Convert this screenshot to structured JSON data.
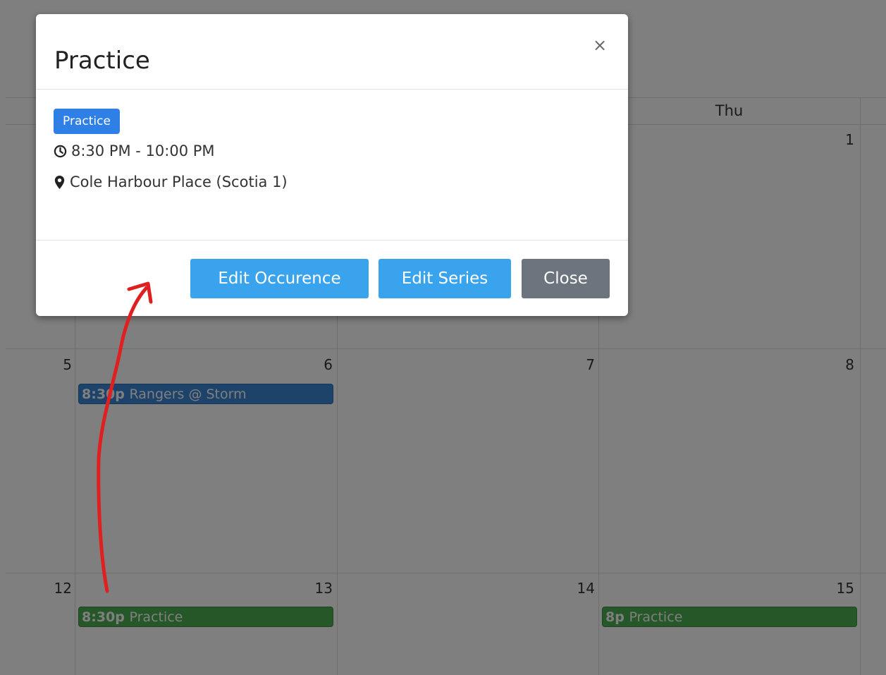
{
  "calendar": {
    "day_header": "Thu",
    "day_numbers": [
      "1",
      "5",
      "6",
      "7",
      "8",
      "12",
      "13",
      "14",
      "15"
    ],
    "events": [
      {
        "time": "8:30p",
        "title": "Rangers @ Storm",
        "kind": "game"
      },
      {
        "time": "8:30p",
        "title": "Practice",
        "kind": "practice"
      },
      {
        "time": "8p",
        "title": "Practice",
        "kind": "practice"
      }
    ]
  },
  "modal": {
    "title": "Practice",
    "close_x": "×",
    "badge": "Practice",
    "time": "8:30 PM - 10:00 PM",
    "location": "Cole Harbour Place (Scotia 1)",
    "buttons": {
      "edit_occurrence": "Edit Occurence",
      "edit_series": "Edit Series",
      "close": "Close"
    }
  },
  "colors": {
    "badge": "#2f80e6",
    "primary_button": "#3aa3ee",
    "secondary_button": "#6c757d",
    "game_event": "#3a87d6",
    "practice_event": "#4caf50",
    "annotation_arrow": "#e02020"
  },
  "icons": [
    "clock-icon",
    "map-marker-icon",
    "close-icon"
  ]
}
